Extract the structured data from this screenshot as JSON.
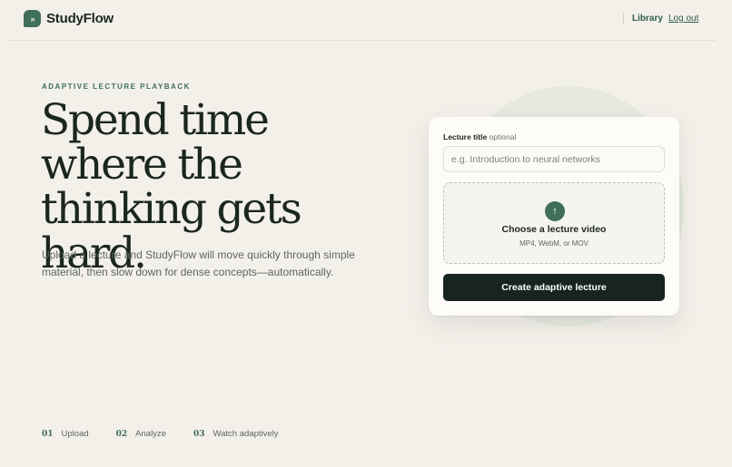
{
  "header": {
    "brand": "StudyFlow",
    "logo_icon": "fast-forward-icon",
    "nav": {
      "library": "Library",
      "logout": "Log out"
    }
  },
  "hero": {
    "eyebrow": "ADAPTIVE LECTURE PLAYBACK",
    "headline": "Spend time where the thinking gets hard.",
    "subtext": "Upload a lecture and StudyFlow will move quickly through simple material, then slow down for dense concepts—automatically."
  },
  "form": {
    "label": "Lecture title",
    "label_optional": "optional",
    "placeholder": "e.g. Introduction to neural networks",
    "value": "",
    "upload_icon": "arrow-up-icon",
    "upload_title": "Choose a lecture video",
    "upload_hint": "MP4, WebM, or MOV",
    "submit": "Create adaptive lecture"
  },
  "steps": [
    {
      "num": "01",
      "label": "Upload"
    },
    {
      "num": "02",
      "label": "Analyze"
    },
    {
      "num": "03",
      "label": "Watch adaptively"
    }
  ],
  "colors": {
    "background": "#f3f0ea",
    "accent": "#3f6e5b",
    "text": "#1b2620",
    "button": "#172420"
  }
}
